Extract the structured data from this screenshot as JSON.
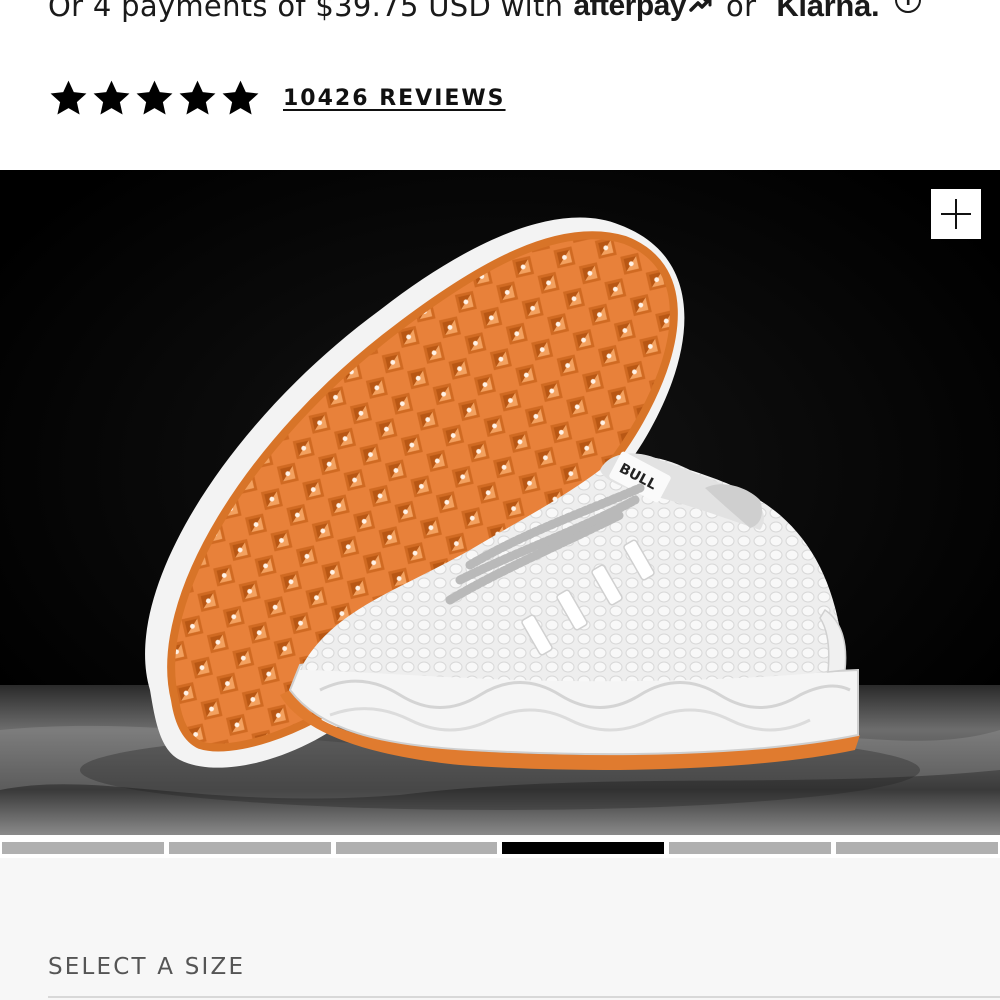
{
  "payments": {
    "text_before": "Or 4 payments of $39.75 USD with",
    "afterpay_label": "afterpay",
    "or_label": "or",
    "klarna_label": "Klarna.",
    "info_icon": "info-icon"
  },
  "rating": {
    "stars": 5,
    "star_icon": "star-icon",
    "reviews_label": "10426 REVIEWS"
  },
  "gallery": {
    "zoom_icon": "plus-icon",
    "brand_text": "BULL",
    "slides": 6,
    "active_slide": 4
  },
  "size": {
    "label": "SELECT A SIZE"
  },
  "colors": {
    "gum_sole": "#e07b2f",
    "shoe_white": "#efefef",
    "background": "#000000",
    "pager_inactive": "#b0b0b0",
    "pager_active": "#000000"
  }
}
